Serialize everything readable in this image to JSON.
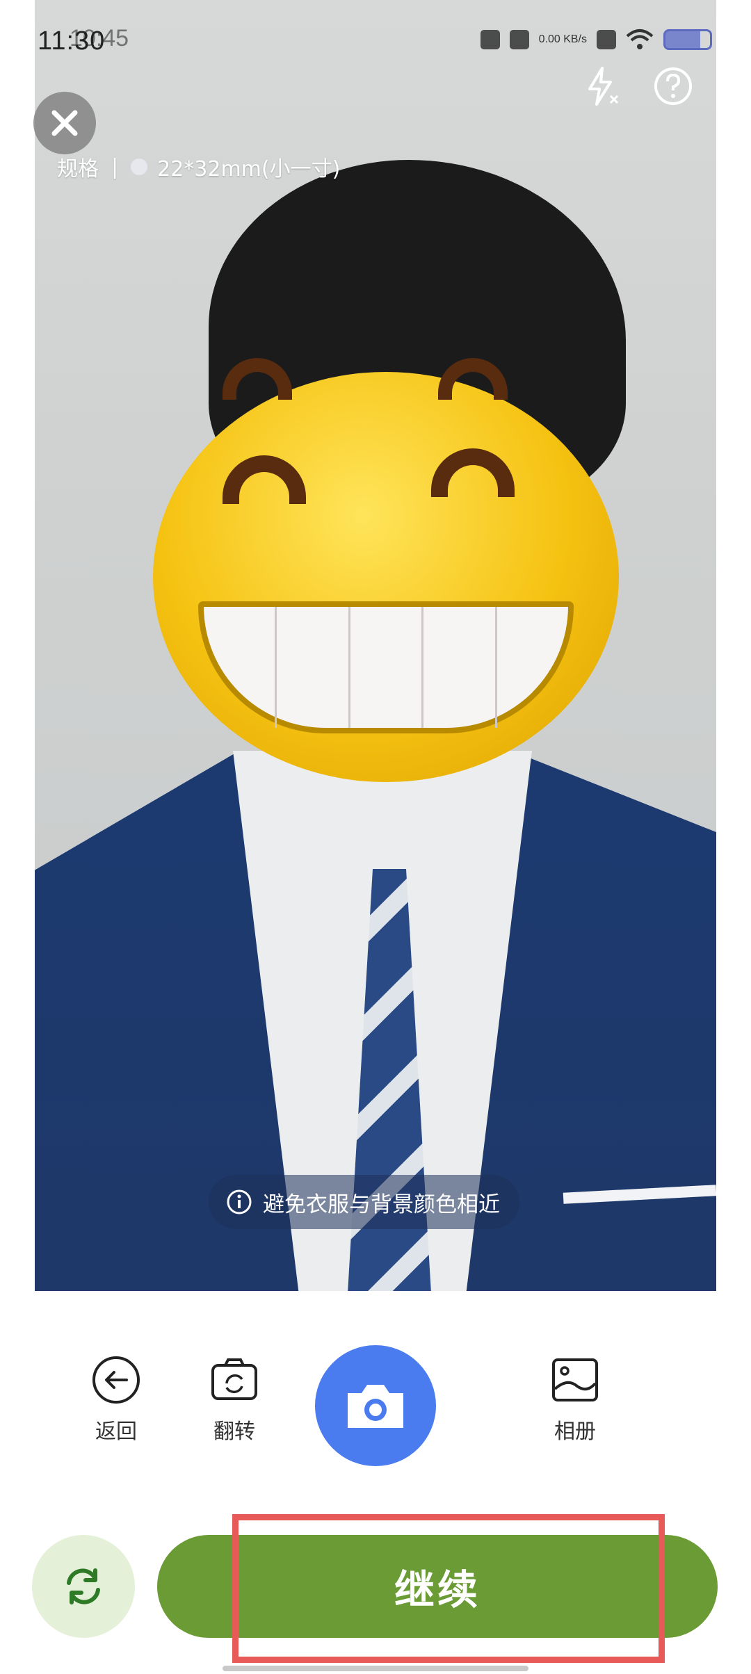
{
  "status_bar": {
    "time": "11:30",
    "time_overlap": "10:45",
    "net_speed": "0.00 KB/s",
    "battery_icon": "battery-icon"
  },
  "camera": {
    "spec_label": "规格",
    "spec_separator": "|",
    "spec_value": "22*32mm(小一寸)",
    "tip": "避免衣服与背景颜色相近"
  },
  "toolbar": {
    "back_label": "返回",
    "flip_label": "翻转",
    "album_label": "相册"
  },
  "actions": {
    "continue_label": "继续"
  },
  "colors": {
    "shutter": "#4a7cf0",
    "continue": "#6a9b34",
    "switch_bg": "#e4f0d8",
    "highlight": "#e85a57"
  }
}
